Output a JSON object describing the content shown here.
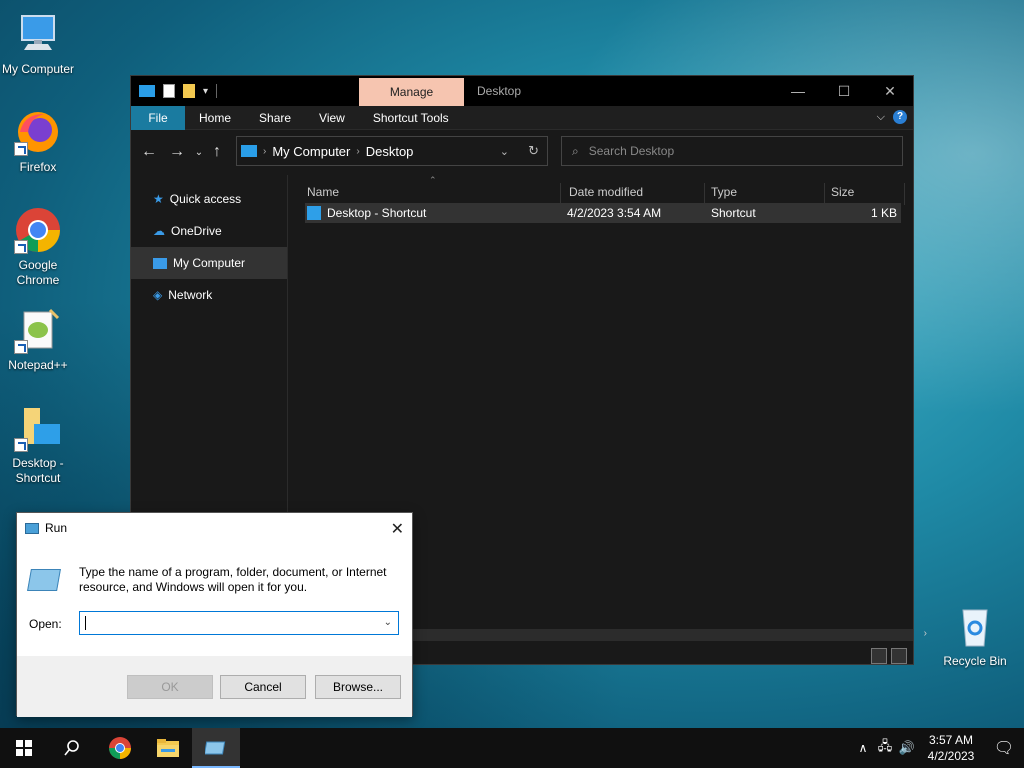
{
  "desktop": {
    "icons": [
      {
        "label": "My Computer"
      },
      {
        "label": "Firefox"
      },
      {
        "label": "Google Chrome"
      },
      {
        "label": "Notepad++"
      },
      {
        "label": "Desktop - Shortcut"
      },
      {
        "label": "Recycle Bin"
      }
    ]
  },
  "explorer": {
    "context_tab": "Manage",
    "title": "Desktop",
    "ribbon_tabs": [
      "File",
      "Home",
      "Share",
      "View",
      "Shortcut Tools"
    ],
    "address": [
      "My Computer",
      "Desktop"
    ],
    "search_placeholder": "Search Desktop",
    "nav": [
      "Quick access",
      "OneDrive",
      "My Computer",
      "Network"
    ],
    "columns": [
      "Name",
      "Date modified",
      "Type",
      "Size"
    ],
    "files": [
      {
        "name": "Desktop - Shortcut",
        "date": "4/2/2023 3:54 AM",
        "type": "Shortcut",
        "size": "1 KB"
      }
    ]
  },
  "run": {
    "title": "Run",
    "description": "Type the name of a program, folder, document, or Internet resource, and Windows will open it for you.",
    "open_label": "Open:",
    "input_value": "",
    "buttons": {
      "ok": "OK",
      "cancel": "Cancel",
      "browse": "Browse..."
    }
  },
  "taskbar": {
    "time": "3:57 AM",
    "date": "4/2/2023"
  }
}
